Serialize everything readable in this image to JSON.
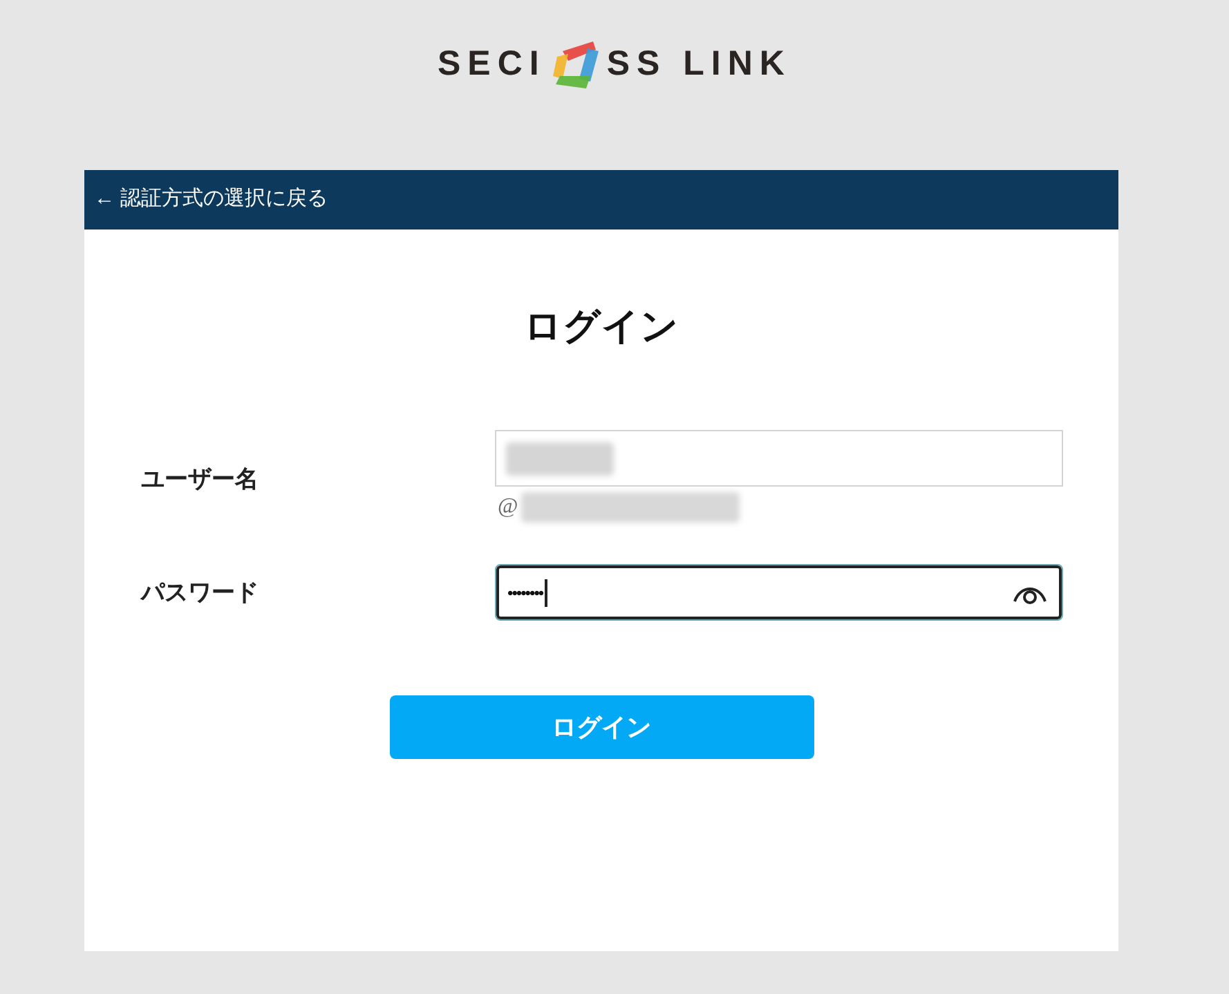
{
  "logo": {
    "text_before": "SECI",
    "text_after": "SS LINK"
  },
  "back_link": {
    "label": "← 認証方式の選択に戻る"
  },
  "title": "ログイン",
  "fields": [
    {
      "kind": "text",
      "label": "ユーザー名",
      "redacted": true,
      "focused": false,
      "domain": {
        "prefix": "@",
        "redacted": true
      }
    },
    {
      "kind": "password",
      "label": "パスワード",
      "value": "••••••••",
      "focused": true
    }
  ],
  "submit_button": {
    "label": "ログイン"
  }
}
